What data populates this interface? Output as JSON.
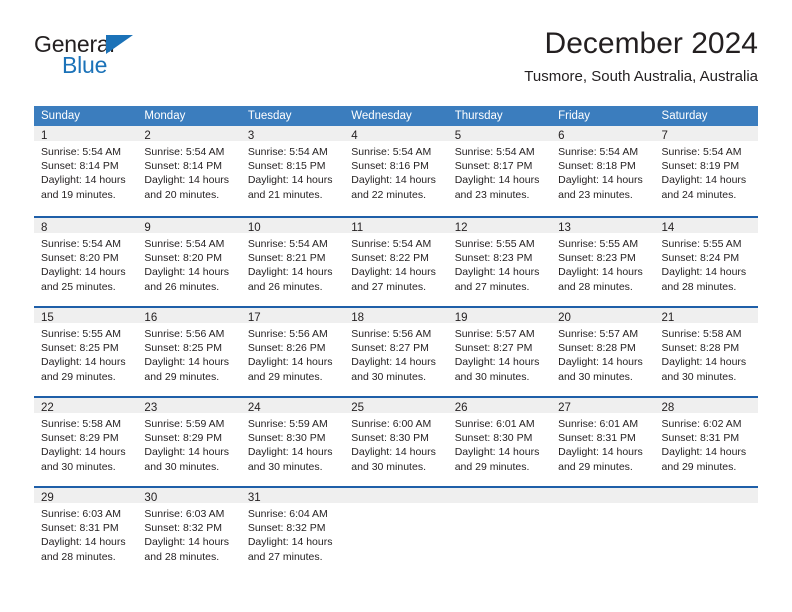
{
  "brand": {
    "name_top": "General",
    "name_bottom": "Blue",
    "color_blue": "#1b72b8",
    "color_dark": "#231f20"
  },
  "header": {
    "title": "December 2024",
    "subtitle": "Tusmore, South Australia, Australia"
  },
  "theme": {
    "header_bg": "#3b7dbe",
    "header_text": "#ffffff",
    "row_divider": "#1f5fa8",
    "daynum_band": "#efefef",
    "body_text": "#231f20"
  },
  "calendar": {
    "weekday_headers": [
      "Sunday",
      "Monday",
      "Tuesday",
      "Wednesday",
      "Thursday",
      "Friday",
      "Saturday"
    ],
    "weeks": [
      [
        {
          "day": "1",
          "l1": "Sunrise: 5:54 AM",
          "l2": "Sunset: 8:14 PM",
          "l3": "Daylight: 14 hours",
          "l4": "and 19 minutes."
        },
        {
          "day": "2",
          "l1": "Sunrise: 5:54 AM",
          "l2": "Sunset: 8:14 PM",
          "l3": "Daylight: 14 hours",
          "l4": "and 20 minutes."
        },
        {
          "day": "3",
          "l1": "Sunrise: 5:54 AM",
          "l2": "Sunset: 8:15 PM",
          "l3": "Daylight: 14 hours",
          "l4": "and 21 minutes."
        },
        {
          "day": "4",
          "l1": "Sunrise: 5:54 AM",
          "l2": "Sunset: 8:16 PM",
          "l3": "Daylight: 14 hours",
          "l4": "and 22 minutes."
        },
        {
          "day": "5",
          "l1": "Sunrise: 5:54 AM",
          "l2": "Sunset: 8:17 PM",
          "l3": "Daylight: 14 hours",
          "l4": "and 23 minutes."
        },
        {
          "day": "6",
          "l1": "Sunrise: 5:54 AM",
          "l2": "Sunset: 8:18 PM",
          "l3": "Daylight: 14 hours",
          "l4": "and 23 minutes."
        },
        {
          "day": "7",
          "l1": "Sunrise: 5:54 AM",
          "l2": "Sunset: 8:19 PM",
          "l3": "Daylight: 14 hours",
          "l4": "and 24 minutes."
        }
      ],
      [
        {
          "day": "8",
          "l1": "Sunrise: 5:54 AM",
          "l2": "Sunset: 8:20 PM",
          "l3": "Daylight: 14 hours",
          "l4": "and 25 minutes."
        },
        {
          "day": "9",
          "l1": "Sunrise: 5:54 AM",
          "l2": "Sunset: 8:20 PM",
          "l3": "Daylight: 14 hours",
          "l4": "and 26 minutes."
        },
        {
          "day": "10",
          "l1": "Sunrise: 5:54 AM",
          "l2": "Sunset: 8:21 PM",
          "l3": "Daylight: 14 hours",
          "l4": "and 26 minutes."
        },
        {
          "day": "11",
          "l1": "Sunrise: 5:54 AM",
          "l2": "Sunset: 8:22 PM",
          "l3": "Daylight: 14 hours",
          "l4": "and 27 minutes."
        },
        {
          "day": "12",
          "l1": "Sunrise: 5:55 AM",
          "l2": "Sunset: 8:23 PM",
          "l3": "Daylight: 14 hours",
          "l4": "and 27 minutes."
        },
        {
          "day": "13",
          "l1": "Sunrise: 5:55 AM",
          "l2": "Sunset: 8:23 PM",
          "l3": "Daylight: 14 hours",
          "l4": "and 28 minutes."
        },
        {
          "day": "14",
          "l1": "Sunrise: 5:55 AM",
          "l2": "Sunset: 8:24 PM",
          "l3": "Daylight: 14 hours",
          "l4": "and 28 minutes."
        }
      ],
      [
        {
          "day": "15",
          "l1": "Sunrise: 5:55 AM",
          "l2": "Sunset: 8:25 PM",
          "l3": "Daylight: 14 hours",
          "l4": "and 29 minutes."
        },
        {
          "day": "16",
          "l1": "Sunrise: 5:56 AM",
          "l2": "Sunset: 8:25 PM",
          "l3": "Daylight: 14 hours",
          "l4": "and 29 minutes."
        },
        {
          "day": "17",
          "l1": "Sunrise: 5:56 AM",
          "l2": "Sunset: 8:26 PM",
          "l3": "Daylight: 14 hours",
          "l4": "and 29 minutes."
        },
        {
          "day": "18",
          "l1": "Sunrise: 5:56 AM",
          "l2": "Sunset: 8:27 PM",
          "l3": "Daylight: 14 hours",
          "l4": "and 30 minutes."
        },
        {
          "day": "19",
          "l1": "Sunrise: 5:57 AM",
          "l2": "Sunset: 8:27 PM",
          "l3": "Daylight: 14 hours",
          "l4": "and 30 minutes."
        },
        {
          "day": "20",
          "l1": "Sunrise: 5:57 AM",
          "l2": "Sunset: 8:28 PM",
          "l3": "Daylight: 14 hours",
          "l4": "and 30 minutes."
        },
        {
          "day": "21",
          "l1": "Sunrise: 5:58 AM",
          "l2": "Sunset: 8:28 PM",
          "l3": "Daylight: 14 hours",
          "l4": "and 30 minutes."
        }
      ],
      [
        {
          "day": "22",
          "l1": "Sunrise: 5:58 AM",
          "l2": "Sunset: 8:29 PM",
          "l3": "Daylight: 14 hours",
          "l4": "and 30 minutes."
        },
        {
          "day": "23",
          "l1": "Sunrise: 5:59 AM",
          "l2": "Sunset: 8:29 PM",
          "l3": "Daylight: 14 hours",
          "l4": "and 30 minutes."
        },
        {
          "day": "24",
          "l1": "Sunrise: 5:59 AM",
          "l2": "Sunset: 8:30 PM",
          "l3": "Daylight: 14 hours",
          "l4": "and 30 minutes."
        },
        {
          "day": "25",
          "l1": "Sunrise: 6:00 AM",
          "l2": "Sunset: 8:30 PM",
          "l3": "Daylight: 14 hours",
          "l4": "and 30 minutes."
        },
        {
          "day": "26",
          "l1": "Sunrise: 6:01 AM",
          "l2": "Sunset: 8:30 PM",
          "l3": "Daylight: 14 hours",
          "l4": "and 29 minutes."
        },
        {
          "day": "27",
          "l1": "Sunrise: 6:01 AM",
          "l2": "Sunset: 8:31 PM",
          "l3": "Daylight: 14 hours",
          "l4": "and 29 minutes."
        },
        {
          "day": "28",
          "l1": "Sunrise: 6:02 AM",
          "l2": "Sunset: 8:31 PM",
          "l3": "Daylight: 14 hours",
          "l4": "and 29 minutes."
        }
      ],
      [
        {
          "day": "29",
          "l1": "Sunrise: 6:03 AM",
          "l2": "Sunset: 8:31 PM",
          "l3": "Daylight: 14 hours",
          "l4": "and 28 minutes."
        },
        {
          "day": "30",
          "l1": "Sunrise: 6:03 AM",
          "l2": "Sunset: 8:32 PM",
          "l3": "Daylight: 14 hours",
          "l4": "and 28 minutes."
        },
        {
          "day": "31",
          "l1": "Sunrise: 6:04 AM",
          "l2": "Sunset: 8:32 PM",
          "l3": "Daylight: 14 hours",
          "l4": "and 27 minutes."
        },
        {
          "day": "",
          "l1": "",
          "l2": "",
          "l3": "",
          "l4": ""
        },
        {
          "day": "",
          "l1": "",
          "l2": "",
          "l3": "",
          "l4": ""
        },
        {
          "day": "",
          "l1": "",
          "l2": "",
          "l3": "",
          "l4": ""
        },
        {
          "day": "",
          "l1": "",
          "l2": "",
          "l3": "",
          "l4": ""
        }
      ]
    ]
  }
}
